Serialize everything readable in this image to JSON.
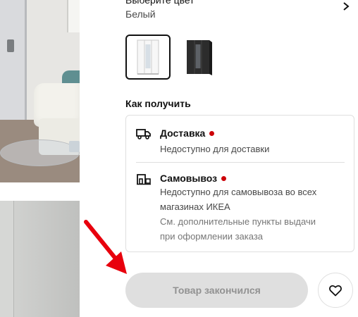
{
  "color_selector": {
    "header_label": "Выберите цвет",
    "selected_value": "Белый",
    "swatches": [
      {
        "name": "white",
        "selected": true
      },
      {
        "name": "black",
        "selected": false
      }
    ]
  },
  "delivery": {
    "section_title": "Как получить",
    "shipping": {
      "icon": "truck-icon",
      "title": "Доставка",
      "status_color": "#cc0008",
      "lines": [
        "Недоступно для доставки"
      ]
    },
    "pickup": {
      "icon": "store-pickup-icon",
      "title": "Самовывоз",
      "status_color": "#cc0008",
      "lines": [
        "Недоступно для самовывоза во всех",
        "магазинах ИКЕА"
      ],
      "note_lines": [
        "См. дополнительные пункты выдачи",
        "при оформлении заказа"
      ]
    }
  },
  "actions": {
    "sold_out_label": "Товар закончился",
    "favourite_icon": "heart-icon"
  },
  "annotation": {
    "arrow_color": "#e8000d"
  }
}
